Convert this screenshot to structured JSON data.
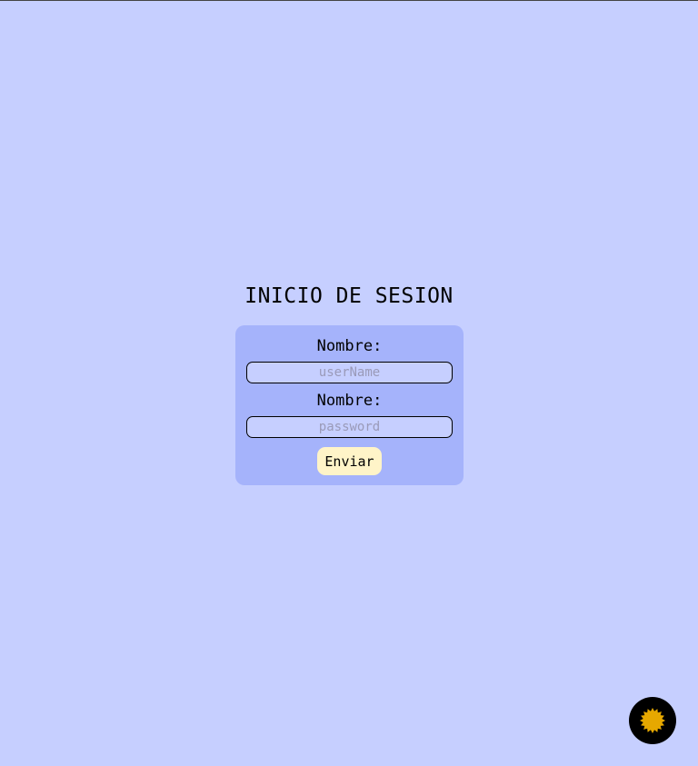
{
  "page": {
    "title": "INICIO DE SESION"
  },
  "form": {
    "username_label": "Nombre:",
    "username_placeholder": "userName",
    "username_value": "",
    "password_label": "Nombre:",
    "password_placeholder": "password",
    "password_value": "",
    "submit_label": "Enviar"
  },
  "theme_toggle": {
    "icon": "sun-icon",
    "icon_color": "#e6a800",
    "background": "#000000"
  },
  "colors": {
    "page_background": "#c6cfff",
    "card_background": "#a5b3fb",
    "button_background": "#fff4c8"
  }
}
